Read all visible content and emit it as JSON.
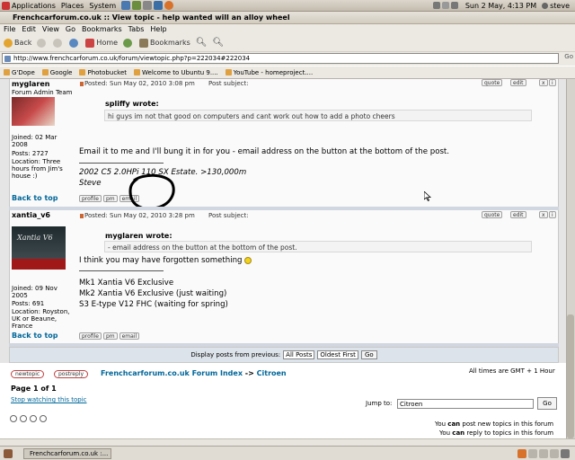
{
  "system_bar": {
    "menus": [
      "Applications",
      "Places",
      "System"
    ],
    "clock": "Sun  2 May,  4:13 PM",
    "user": "steve"
  },
  "window_title": "Frenchcarforum.co.uk :: View topic - help wanted will an alloy wheel",
  "menu": [
    "File",
    "Edit",
    "View",
    "Go",
    "Bookmarks",
    "Tabs",
    "Help"
  ],
  "nav": {
    "back": "Back",
    "home": "Home",
    "bookmarks": "Bookmarks"
  },
  "url": "http://www.frenchcarforum.co.uk/forum/viewtopic.php?p=222034#222034",
  "go": "Go",
  "bookmarks": [
    "G'Dope",
    "Google",
    "Photobucket",
    "Welcome to Ubuntu 9....",
    "YouTube - homeproject...."
  ],
  "post1": {
    "username": "myglaren",
    "rank": "Forum Admin Team",
    "joined": "Joined: 02 Mar 2008",
    "posts": "Posts: 2727",
    "location": "Location: Three hours from Jim's house :)",
    "posted": "Posted: Sun May 02, 2010 3:08 pm",
    "subject": "Post subject:",
    "quote_author": "spliffy wrote:",
    "quote_text": "hi guys im not that good on computers and cant work out how to add a photo cheers",
    "body": "Email it to me and I'll bung it in for you - email address on the button at the bottom of the post.",
    "sig1": "2002 C5 2.0HPi 110 SX Estate. >130,000m",
    "sig2": "Steve"
  },
  "post2": {
    "username": "xantia_v6",
    "avatar_text": "Xantia V6",
    "joined": "Joined: 09 Nov 2005",
    "posts": "Posts: 691",
    "location": "Location: Royston, UK or Beaune, France",
    "posted": "Posted: Sun May 02, 2010 3:28 pm",
    "subject": "Post subject:",
    "quote_author": "myglaren wrote:",
    "quote_text": "- email address on the button at the bottom of the post.",
    "body": "I think you may have forgotten something",
    "sig1": "Mk1 Xantia V6 Exclusive",
    "sig2": "Mk2 Xantia V6 Exclusive (just waiting)",
    "sig3": "S3 E-type V12 FHC (waiting for spring)"
  },
  "buttons": {
    "quote": "quote",
    "edit": "edit",
    "profile": "profile",
    "pm": "pm",
    "email": "email",
    "back_to_top": "Back to top"
  },
  "display_bar": {
    "label": "Display posts from previous:",
    "posts_select": "All Posts",
    "order_select": "Oldest First",
    "go": "Go"
  },
  "bottom": {
    "newtopic": "newtopic",
    "postreply": "postreply",
    "breadcrumb_index": "Frenchcarforum.co.uk Forum Index",
    "breadcrumb_sep": "->",
    "breadcrumb_forum": "Citroen",
    "timezone": "All times are GMT + 1 Hour",
    "page": "Page 1 of 1",
    "stop_watching": "Stop watching this topic",
    "jump_label": "Jump to:",
    "jump_value": "Citroen",
    "jump_go": "Go",
    "perm1_a": "You ",
    "perm1_b": "can",
    "perm1_c": " post new topics in this forum",
    "perm2_a": "You ",
    "perm2_b": "can",
    "perm2_c": " reply to topics in this forum"
  },
  "taskbar": {
    "window": "Frenchcarforum.co.uk :..."
  }
}
